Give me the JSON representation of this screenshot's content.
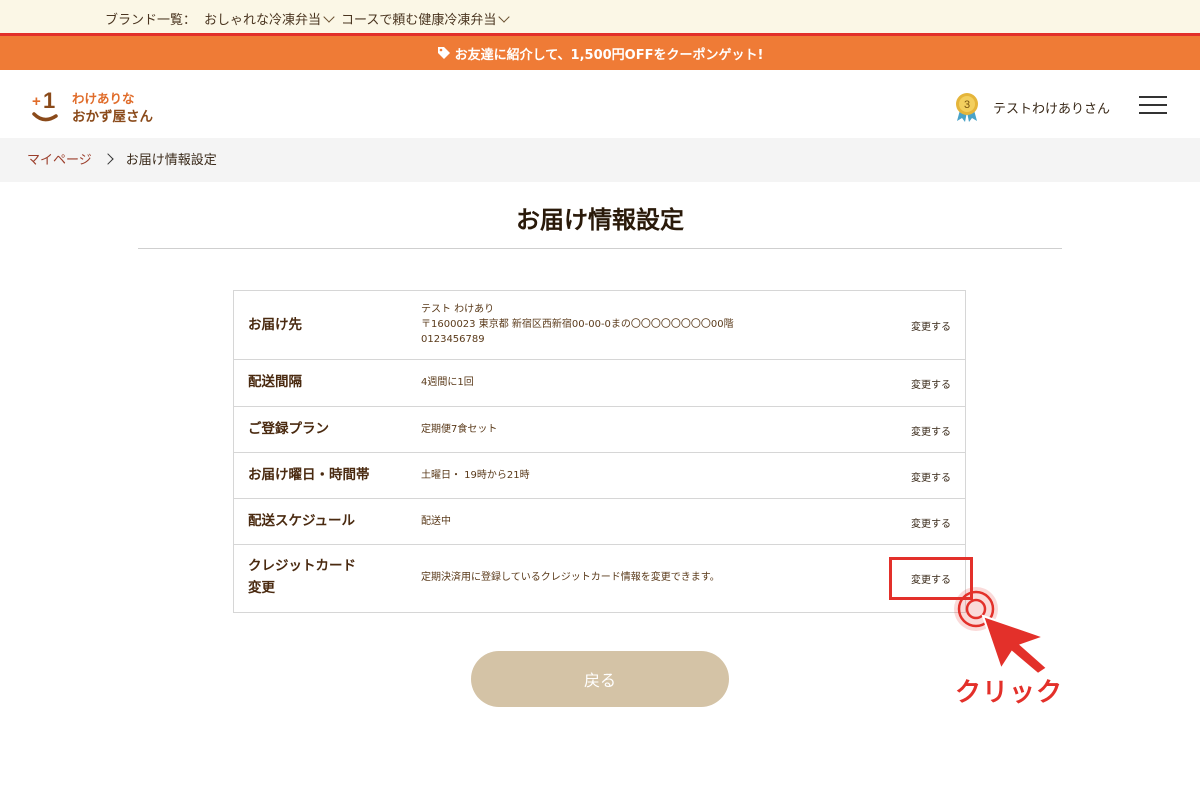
{
  "brand_nav": {
    "prefix": "ブランド一覧：",
    "items": [
      "おしゃれな冷凍弁当",
      "コースで頼む健康冷凍弁当"
    ]
  },
  "promo": {
    "text": "お友達に紹介して、1,500円OFFをクーポンゲット!",
    "icon": "tag-icon"
  },
  "header": {
    "logo_text_line1": "わけありな",
    "logo_text_line2": "おかず屋さん",
    "logo_mark": "+1",
    "rank_badge": "3",
    "user_name": "テストわけありさん"
  },
  "breadcrumb": {
    "home": "マイページ",
    "current": "お届け情報設定"
  },
  "page_title": "お届け情報設定",
  "rows": [
    {
      "label": "お届け先",
      "value_lines": [
        "テスト わけあり",
        "〒1600023 東京都 新宿区西新宿00-00-0まの〇〇〇〇〇〇〇〇00階",
        "0123456789"
      ],
      "action": "変更する"
    },
    {
      "label": "配送間隔",
      "value_lines": [
        "4週間に1回"
      ],
      "action": "変更する"
    },
    {
      "label": "ご登録プラン",
      "value_lines": [
        "定期便7食セット"
      ],
      "action": "変更する"
    },
    {
      "label": "お届け曜日・時間帯",
      "value_lines": [
        "土曜日・ 19時から21時"
      ],
      "action": "変更する"
    },
    {
      "label": "配送スケジュール",
      "value_lines": [
        "配送中"
      ],
      "action": "変更する"
    },
    {
      "label_lines": [
        "クレジットカード",
        "変更"
      ],
      "value_lines": [
        "定期決済用に登録しているクレジットカード情報を変更できます。"
      ],
      "action": "変更する"
    }
  ],
  "back_button": "戻る",
  "annotation": {
    "label": "クリック"
  },
  "colors": {
    "accent_red": "#e3302a",
    "promo_orange": "#ef7b36",
    "back_button": "#d4c3a6",
    "logo_brown": "#8a4a1a"
  }
}
